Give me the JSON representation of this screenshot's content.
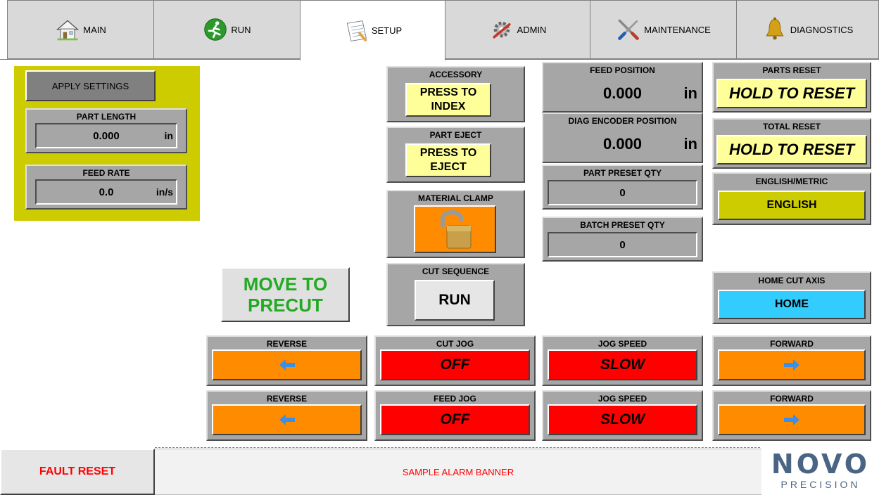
{
  "tabs": [
    {
      "label": "MAIN",
      "icon": "house-icon"
    },
    {
      "label": "RUN",
      "icon": "runner-icon"
    },
    {
      "label": "SETUP",
      "icon": "notepad-icon"
    },
    {
      "label": "ADMIN",
      "icon": "gear-tools-icon"
    },
    {
      "label": "MAINTENANCE",
      "icon": "wrench-screwdriver-icon"
    },
    {
      "label": "DIAGNOSTICS",
      "icon": "bell-icon"
    }
  ],
  "settings": {
    "apply_label": "APPLY SETTINGS",
    "part_length": {
      "label": "PART LENGTH",
      "value": "0.000",
      "unit": "in"
    },
    "feed_rate": {
      "label": "FEED RATE",
      "value": "0.0",
      "unit": "in/s"
    }
  },
  "accessory": {
    "label": "ACCESSORY",
    "button_line1": "PRESS TO",
    "button_line2": "INDEX"
  },
  "part_eject": {
    "label": "PART EJECT",
    "button_line1": "PRESS TO",
    "button_line2": "EJECT"
  },
  "material_clamp": {
    "label": "MATERIAL CLAMP",
    "icon": "unlocked-padlock-icon"
  },
  "cut_sequence": {
    "label": "CUT SEQUENCE",
    "button": "RUN"
  },
  "move_precut": {
    "line1": "MOVE TO",
    "line2": "PRECUT"
  },
  "feed_position": {
    "label": "FEED POSITION",
    "value": "0.000",
    "unit": "in"
  },
  "diag_encoder": {
    "label": "DIAG ENCODER POSITION",
    "value": "0.000",
    "unit": "in"
  },
  "part_preset": {
    "label": "PART PRESET QTY",
    "value": "0"
  },
  "batch_preset": {
    "label": "BATCH PRESET QTY",
    "value": "0"
  },
  "parts_reset": {
    "label": "PARTS RESET",
    "button": "HOLD TO RESET"
  },
  "total_reset": {
    "label": "TOTAL RESET",
    "button": "HOLD TO RESET"
  },
  "units": {
    "label": "ENGLISH/METRIC",
    "button": "ENGLISH"
  },
  "home_cut": {
    "label": "HOME CUT AXIS",
    "button": "HOME"
  },
  "jog_row1": {
    "reverse": "REVERSE",
    "jog_label": "CUT JOG",
    "jog_state": "OFF",
    "speed_label": "JOG SPEED",
    "speed_state": "SLOW",
    "forward": "FORWARD"
  },
  "jog_row2": {
    "reverse": "REVERSE",
    "jog_label": "FEED JOG",
    "jog_state": "OFF",
    "speed_label": "JOG SPEED",
    "speed_state": "SLOW",
    "forward": "FORWARD"
  },
  "footer": {
    "fault_reset": "FAULT RESET",
    "alarm_banner": "SAMPLE ALARM BANNER",
    "logo_top": "NOVO",
    "logo_bottom": "PRECISION"
  },
  "colors": {
    "settings_bg": "#cccc00",
    "yellow_btn": "#ffff99",
    "orange": "#ff8c00",
    "red": "#ff0000",
    "cyan": "#33ccff",
    "olive": "#cccc00",
    "green_text": "#22aa22"
  }
}
